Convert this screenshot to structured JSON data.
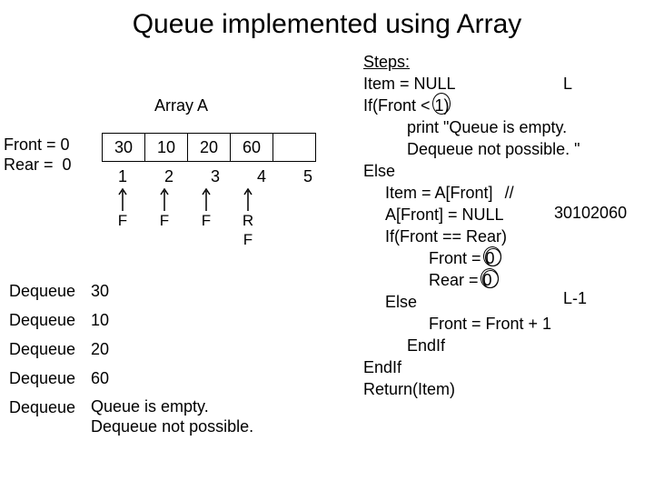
{
  "title": "Queue implemented using Array",
  "array_label": "Array A",
  "front_label": "Front =",
  "front_val": "0",
  "rear_label": "Rear =",
  "rear_val": "0",
  "cells": [
    "30",
    "10",
    "20",
    "60",
    ""
  ],
  "indices": [
    "1",
    "2",
    "3",
    "4",
    "5"
  ],
  "pointers": {
    "c0": "F",
    "c1": "F",
    "c2": "F",
    "c3a": "R",
    "c3b": "F"
  },
  "dequeue_label": "Dequeue",
  "dq": [
    "30",
    "10",
    "20",
    "60"
  ],
  "dq_empty_msg_l1": "Queue is empty.",
  "dq_empty_msg_l2": "Dequeue not possible.",
  "steps_title": "Steps:",
  "line1a": "Item = NULL",
  "line2a": "If(Front < ",
  "line2b": "1",
  "line2c": ")",
  "L_label": "L",
  "line3": "print \"Queue is empty.",
  "line4": "Dequeue not possible. \"",
  "line5": "Else",
  "line6": "Item = A[Front]",
  "comment_slashes": "//",
  "comment_vals": "30102060",
  "line7": "A[Front] = NULL",
  "line8": "If(Front == Rear)",
  "line9a": "Front = ",
  "line9b": "0",
  "line10a": "Rear = ",
  "line10b": "0",
  "L1_label": "L-1",
  "line11": "Else",
  "line12": "Front = Front  + 1",
  "line13": "EndIf",
  "line14": "EndIf",
  "line15": "Return(Item)"
}
